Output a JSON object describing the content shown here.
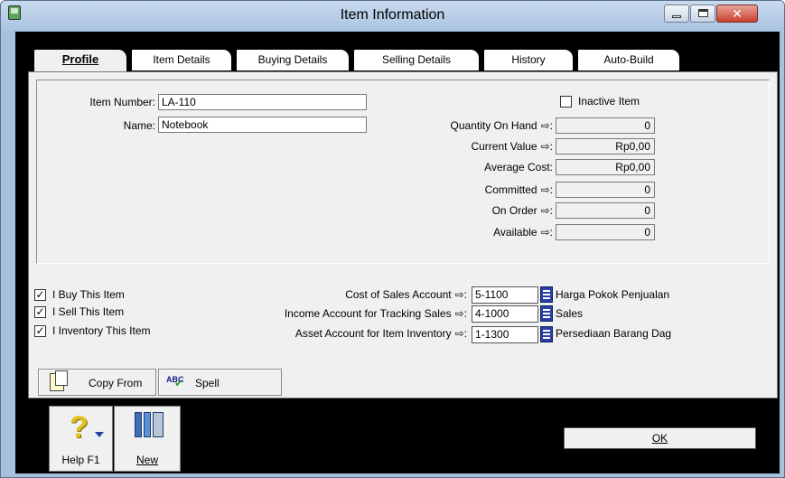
{
  "window": {
    "title": "Item Information"
  },
  "tabs": [
    {
      "label": "Profile",
      "active": true
    },
    {
      "label": "Item Details",
      "active": false
    },
    {
      "label": "Buying Details",
      "active": false
    },
    {
      "label": "Selling Details",
      "active": false
    },
    {
      "label": "History",
      "active": false
    },
    {
      "label": "Auto-Build",
      "active": false
    }
  ],
  "profile": {
    "item_number_label": "Item Number:",
    "item_number": "LA-110",
    "name_label": "Name:",
    "name": "Notebook",
    "inactive_label": "Inactive Item",
    "inactive_checked": false,
    "stats": [
      {
        "label": "Quantity On Hand",
        "arrow": true,
        "value": "0"
      },
      {
        "label": "Current Value",
        "arrow": true,
        "value": "Rp0,00"
      },
      {
        "label": "Average Cost:",
        "arrow": false,
        "value": "Rp0,00"
      },
      {
        "label": "Committed",
        "arrow": true,
        "value": "0"
      },
      {
        "label": "On Order",
        "arrow": true,
        "value": "0"
      },
      {
        "label": "Available",
        "arrow": true,
        "value": "0"
      }
    ]
  },
  "flags": [
    {
      "label": "I Buy This Item",
      "checked": true
    },
    {
      "label": "I Sell This Item",
      "checked": true
    },
    {
      "label": "I Inventory This Item",
      "checked": true
    }
  ],
  "accounts": [
    {
      "label": "Cost of Sales Account",
      "number": "5-1100",
      "name": "Harga Pokok Penjualan"
    },
    {
      "label": "Income Account for Tracking Sales",
      "number": "4-1000",
      "name": "Sales"
    },
    {
      "label": "Asset Account for Item Inventory",
      "number": "1-1300",
      "name": "Persediaan Barang Dag"
    }
  ],
  "buttons": {
    "copy_from": "Copy From",
    "spell": "Spell",
    "help": "Help F1",
    "new": "New",
    "ok": "OK"
  },
  "icons": {
    "app": "myob-window-icon",
    "minimize": "minimize-icon",
    "maximize": "maximize-icon",
    "close": "close-icon",
    "copy": "copy-icon",
    "spell": "spellcheck-icon",
    "help": "help-question-icon",
    "new": "new-books-icon",
    "arrow": "zoom-arrow-icon",
    "lookup": "list-lookup-icon"
  }
}
